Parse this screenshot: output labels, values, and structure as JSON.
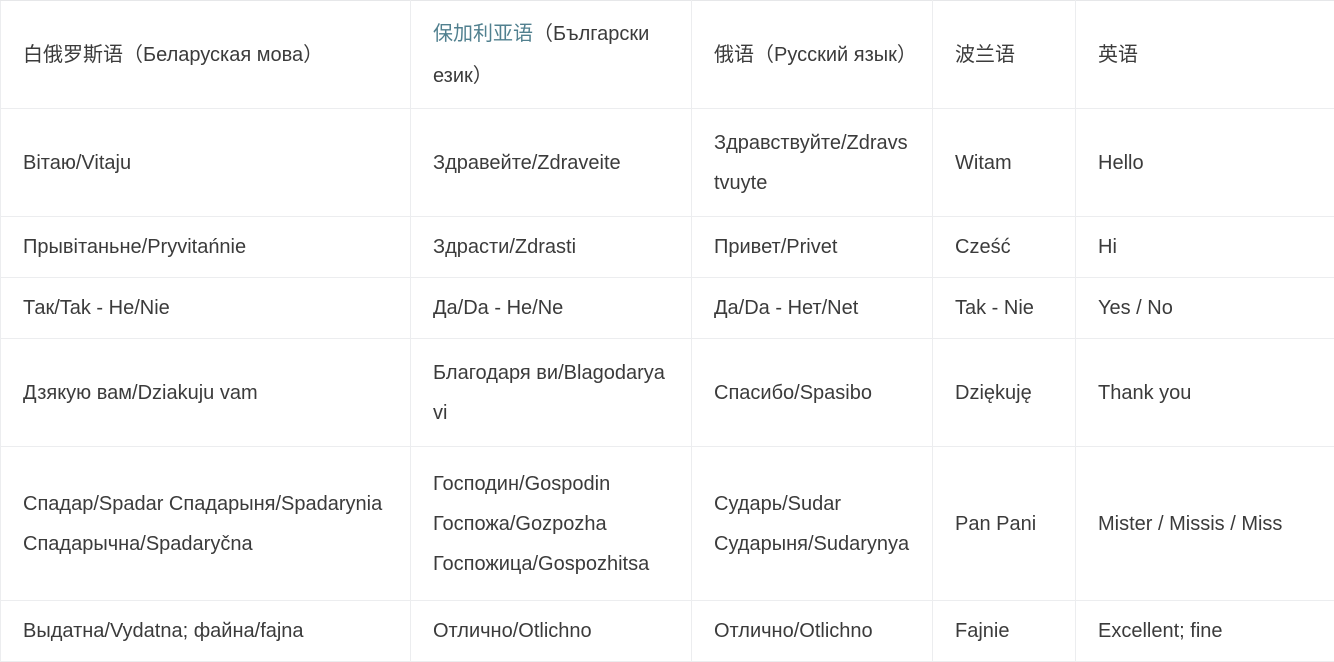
{
  "table": {
    "columns": [
      {
        "id": "belarusian",
        "label_link": "",
        "label": "白俄罗斯语（Беларуская мова）"
      },
      {
        "id": "bulgarian",
        "label_link": "保加利亚语",
        "label": "（Български език）"
      },
      {
        "id": "russian",
        "label_link": "",
        "label": "俄语（Русский язык）"
      },
      {
        "id": "polish",
        "label_link": "",
        "label": "波兰语"
      },
      {
        "id": "english",
        "label_link": "",
        "label": "英语"
      }
    ],
    "rows": [
      {
        "belarusian": "Вітаю/Vitaju",
        "bulgarian": "Здравейте/Zdraveite",
        "russian": "Здравствуйте/Zdravstvuyte",
        "polish": "Witam",
        "english": "Hello"
      },
      {
        "belarusian": "Прывітаньне/Pryvitańnie",
        "bulgarian": "Здрасти/Zdrasti",
        "russian": "Привет/Privet",
        "polish": "Cześć",
        "english": "Hi"
      },
      {
        "belarusian": "Так/Tak - Не/Nie",
        "bulgarian": "Да/Da - Не/Ne",
        "russian": "Да/Da - Нет/Net",
        "polish": "Tak - Nie",
        "english": "Yes / No"
      },
      {
        "belarusian": "Дзякую вам/Dziakuju vam",
        "bulgarian": "Благодаря ви/Blagodarya vi",
        "russian": "Спасибо/Spasibo",
        "polish": "Dziękuję",
        "english": "Thank you"
      },
      {
        "belarusian": "Спадар/Spadar Спадарыня/Spadarynia Спадарычна/Spadaryčna",
        "bulgarian": "Господин/Gospodin Госпожа/Gozpozha Госпожица/Gospozhitsa",
        "russian": "Сударь/Sudar Сударыня/Sudarynya",
        "polish": "Pan Pani",
        "english": "Mister / Missis / Miss"
      },
      {
        "belarusian": "Выдатна/Vydatna; файна/fajna",
        "bulgarian": "Отлично/Otlichno",
        "russian": "Отлично/Otlichno",
        "polish": "Fajnie",
        "english": "Excellent; fine"
      }
    ]
  },
  "colors": {
    "link": "#51808f",
    "text": "#3b3b3b",
    "border": "#ecedef",
    "background": "#ffffff"
  }
}
